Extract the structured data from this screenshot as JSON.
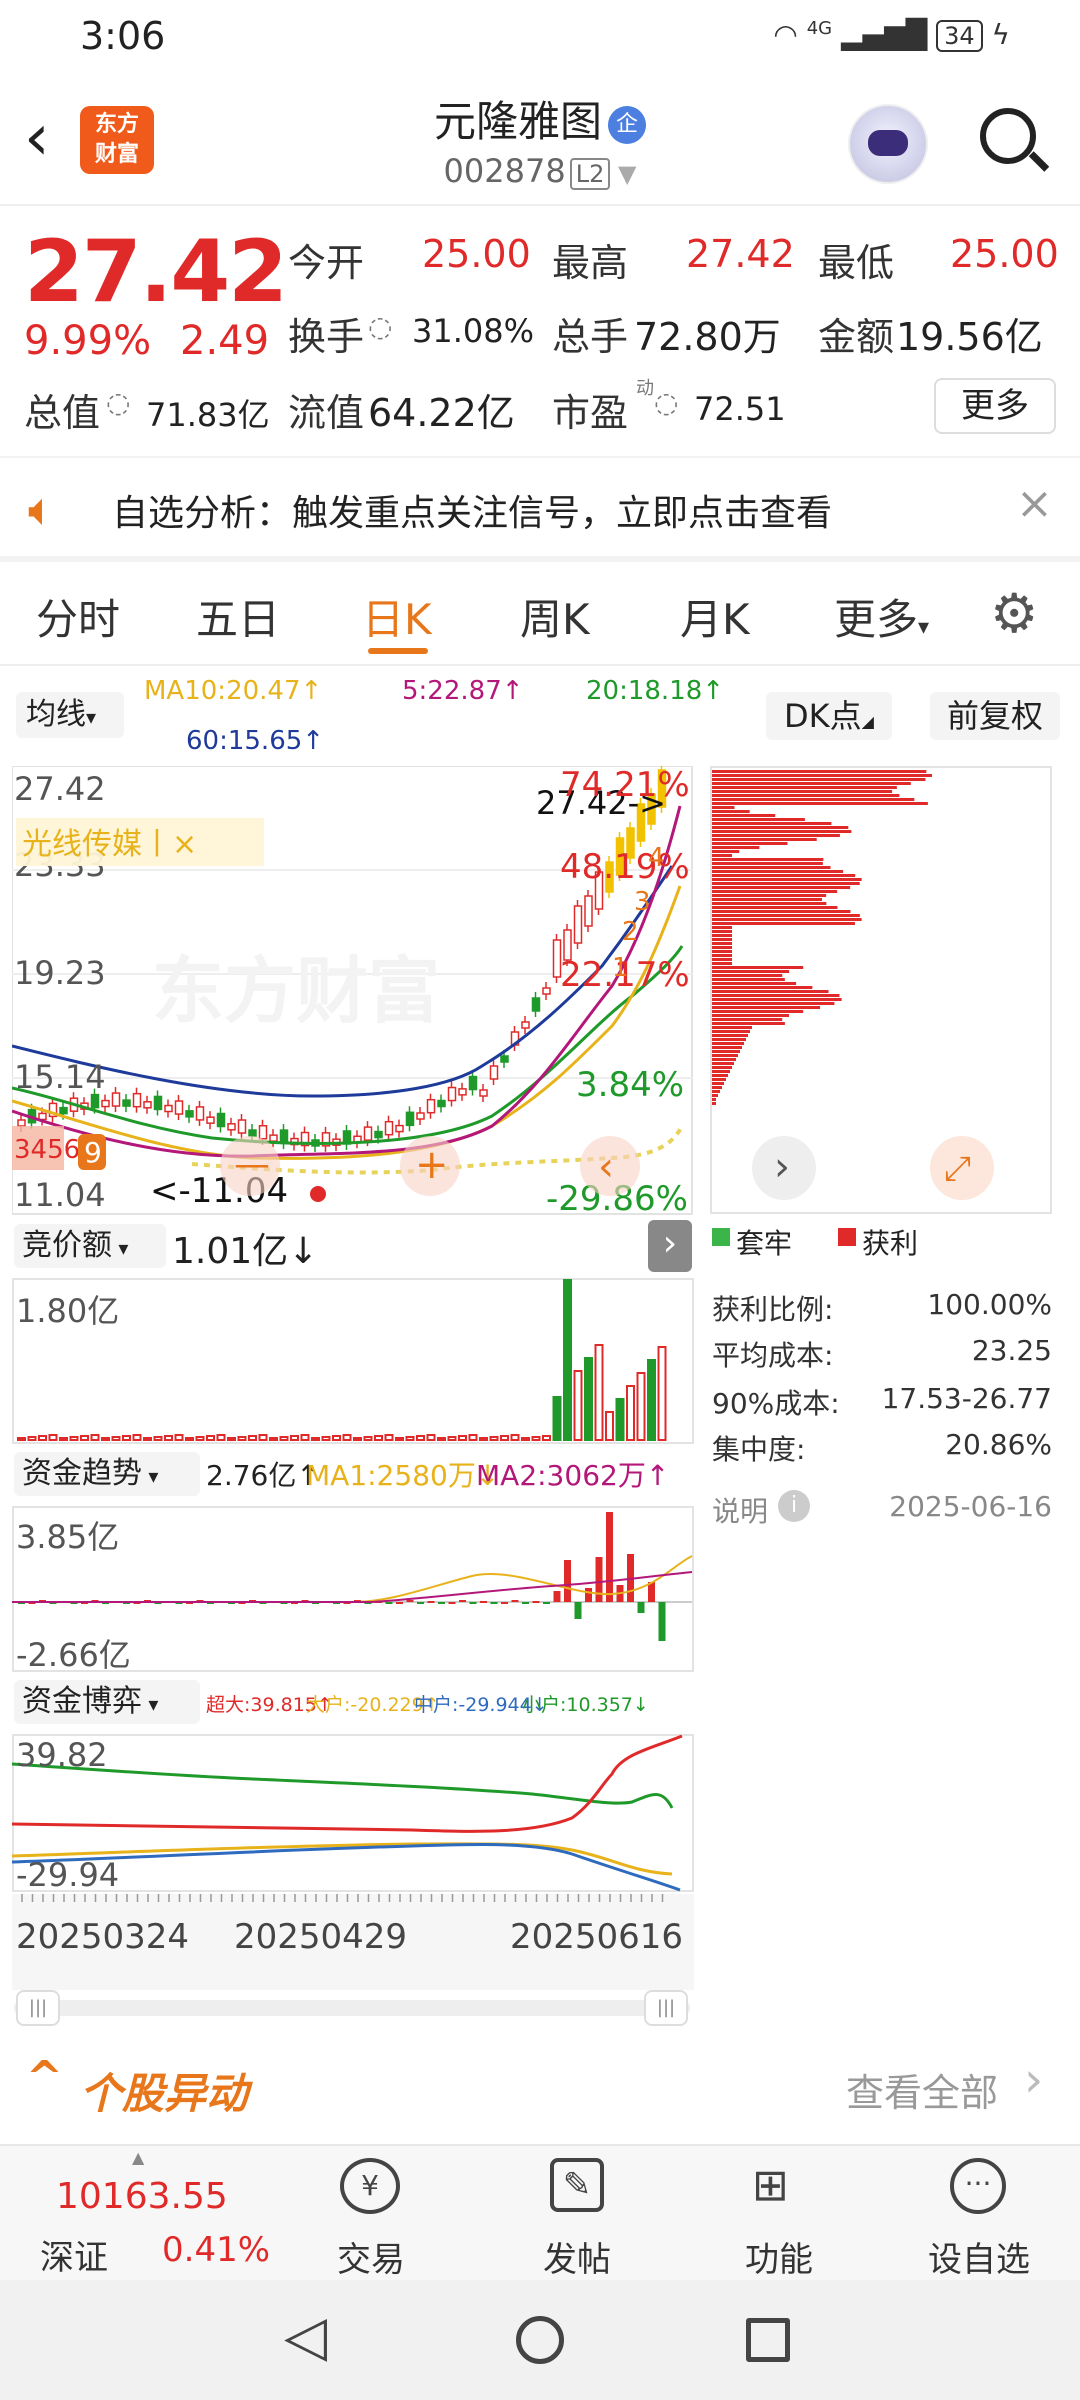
{
  "status_bar": {
    "time": "3:06",
    "network": "4G",
    "battery": "34"
  },
  "header": {
    "stock_name": "元隆雅图",
    "verify_badge": "企",
    "stock_code": "002878",
    "level_badge": "L2",
    "logo_text_1": "东方",
    "logo_text_2": "财富"
  },
  "quote": {
    "price": "27.42",
    "change_pct": "9.99%",
    "change": "2.49",
    "open_label": "今开",
    "open": "25.00",
    "high_label": "最高",
    "high": "27.42",
    "low_label": "最低",
    "low": "25.00",
    "turnover_label": "换手",
    "turnover": "31.08%",
    "volume_label": "总手",
    "volume": "72.80万",
    "amount_label": "金额",
    "amount": "19.56亿",
    "mcap_label": "总值",
    "mcap": "71.83亿",
    "float_label": "流值",
    "float": "64.22亿",
    "pe_label": "市盈",
    "pe_sup": "动",
    "pe": "72.51",
    "more_label": "更多"
  },
  "notice": {
    "text": "自选分析：触发重点关注信号，立即点击查看"
  },
  "tabs": {
    "t1": "分时",
    "t2": "五日",
    "t3": "日K",
    "t4": "周K",
    "t5": "月K",
    "t6": "更多",
    "active": "日K"
  },
  "ma_row": {
    "select": "均线",
    "ma10": "MA10:20.47↑",
    "ma5": "5:22.87↑",
    "ma20": "20:18.18↑",
    "ma60": "60:15.65↑",
    "dk": "DK点",
    "fq": "前复权"
  },
  "kline": {
    "y_labels": [
      "27.42",
      "23.33",
      "19.23",
      "15.14",
      "11.04"
    ],
    "watermark": "东方财富",
    "concept_tag": "光线传媒丨×",
    "last_price_marker": "27.42->",
    "low_marker": "<-11.04",
    "pct_labels": [
      "74.21%",
      "48.19%",
      "22.17%",
      "3.84%",
      "-29.86%"
    ],
    "step_labels": [
      "1",
      "2",
      "3",
      "4"
    ],
    "bubble_label": "3456",
    "bubble_num": "9"
  },
  "auction": {
    "select": "竞价额",
    "value": "1.01亿↓",
    "y_top": "1.80亿"
  },
  "fund_trend": {
    "select": "资金趋势",
    "value": "2.76亿↑",
    "ma1": "MA1:2580万↓",
    "ma2": "MA2:3062万↑",
    "y_top": "3.85亿",
    "y_bottom": "-2.66亿"
  },
  "fund_game": {
    "select": "资金博弈",
    "super": "超大:39.815↑",
    "large": "大户:-20.229↑",
    "mid": "中户:-29.944↓",
    "small": "小户:10.357↓",
    "y_top": "39.82",
    "y_bottom": "-29.94",
    "dates": [
      "20250324",
      "20250429",
      "20250616"
    ]
  },
  "chips": {
    "legend_trapped": "套牢",
    "legend_profit": "获利",
    "profit_ratio_label": "获利比例:",
    "profit_ratio": "100.00%",
    "avg_cost_label": "平均成本:",
    "avg_cost": "23.25",
    "cost90_label": "90%成本:",
    "cost90": "17.53-26.77",
    "concentration_label": "集中度:",
    "concentration": "20.86%",
    "note_label": "说明",
    "date": "2025-06-16"
  },
  "movement": {
    "title": "个股异动",
    "view_all": "查看全部"
  },
  "bottom_nav": {
    "index_value": "10163.55",
    "index_name": "深证",
    "index_pct": "0.41%",
    "trade": "交易",
    "post": "发帖",
    "function": "功能",
    "watch": "设自选"
  },
  "colors": {
    "up": "#e02a2a",
    "down": "#1f9a2a",
    "accent": "#e8761a",
    "ma5": "#b3177a",
    "ma10": "#e8b21a",
    "ma20": "#1f9a2a",
    "ma60": "#1e3a9a"
  }
}
